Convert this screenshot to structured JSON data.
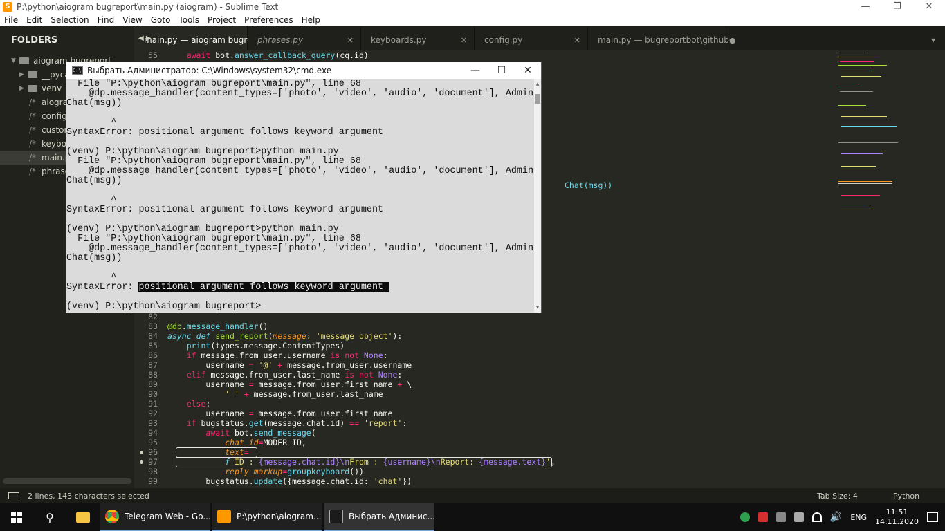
{
  "window": {
    "title": "P:\\python\\aiogram bugreport\\main.py (aiogram) - Sublime Text",
    "minimize": "—",
    "maximize": "❐",
    "close": "✕"
  },
  "menu": [
    "File",
    "Edit",
    "Selection",
    "Find",
    "View",
    "Goto",
    "Tools",
    "Project",
    "Preferences",
    "Help"
  ],
  "sidebar": {
    "header": "FOLDERS",
    "root": "aiogram bugreport",
    "items": [
      {
        "label": "__pycache__",
        "kind": "folder"
      },
      {
        "label": "venv",
        "kind": "folder"
      },
      {
        "label": "aiogram_tpl",
        "kind": "file"
      },
      {
        "label": "config.py",
        "kind": "file"
      },
      {
        "label": "customfilters.py",
        "kind": "file"
      },
      {
        "label": "keyboards.py",
        "kind": "file"
      },
      {
        "label": "main.py",
        "kind": "file"
      },
      {
        "label": "phrase.py",
        "kind": "file"
      }
    ]
  },
  "tabs": [
    {
      "label": "main.py — aiogram bugreport",
      "active": true,
      "italic": false,
      "close": "✕"
    },
    {
      "label": "phrases.py",
      "active": false,
      "italic": true,
      "close": "✕"
    },
    {
      "label": "keyboards.py",
      "active": false,
      "italic": false,
      "close": "✕"
    },
    {
      "label": "config.py",
      "active": false,
      "italic": false,
      "close": "✕"
    },
    {
      "label": "main.py — bugreportbot\\github",
      "active": false,
      "italic": false,
      "close": "●"
    }
  ],
  "tab_overflow": "▾",
  "editor": {
    "visible_line_numbers": [
      55,
      82,
      83,
      84,
      85,
      86,
      87,
      88,
      89,
      90,
      91,
      92,
      93,
      94,
      95,
      96,
      97,
      98,
      99
    ],
    "modified_lines": [
      96,
      97
    ],
    "behind_cmd_line": "Chat(msg))"
  },
  "cmd": {
    "title": "Выбрать Администратор: C:\\Windows\\system32\\cmd.exe",
    "lines": [
      "  File \"P:\\python\\aiogram bugreport\\main.py\", line 68",
      "    @dp.message_handler(content_types=['photo', 'video', 'audio', 'document'], Admin",
      "Chat(msg))",
      "                                                                               ",
      "        ^",
      "SyntaxError: positional argument follows keyword argument",
      "",
      "(venv) P:\\python\\aiogram bugreport>python main.py",
      "  File \"P:\\python\\aiogram bugreport\\main.py\", line 68",
      "    @dp.message_handler(content_types=['photo', 'video', 'audio', 'document'], Admin",
      "Chat(msg))",
      "",
      "        ^",
      "SyntaxError: positional argument follows keyword argument",
      "",
      "(venv) P:\\python\\aiogram bugreport>python main.py",
      "  File \"P:\\python\\aiogram bugreport\\main.py\", line 68",
      "    @dp.message_handler(content_types=['photo', 'video', 'audio', 'document'], Admin",
      "Chat(msg))",
      "",
      "        ^",
      "SyntaxError: ",
      "",
      "(venv) P:\\python\\aiogram bugreport>"
    ],
    "selected_text": "positional argument follows keyword argument "
  },
  "status": {
    "selection": "2 lines, 143 characters selected",
    "tab_size": "Tab Size: 4",
    "syntax": "Python"
  },
  "taskbar": {
    "apps": [
      {
        "label": "Telegram Web - Go...",
        "icon_color": "#e94235"
      },
      {
        "label": "P:\\python\\aiogram...",
        "icon_color": "#ff9800"
      },
      {
        "label": "Выбрать Админис...",
        "icon_color": "#1b1b1b"
      }
    ],
    "lang": "ENG",
    "time": "11:51",
    "date": "14.11.2020"
  },
  "colors": {
    "editor_bg": "#272822",
    "keyword": "#f92672",
    "function": "#66d9ef",
    "string": "#e6db74",
    "arg": "#fd971f",
    "decorator": "#a6e22e"
  }
}
